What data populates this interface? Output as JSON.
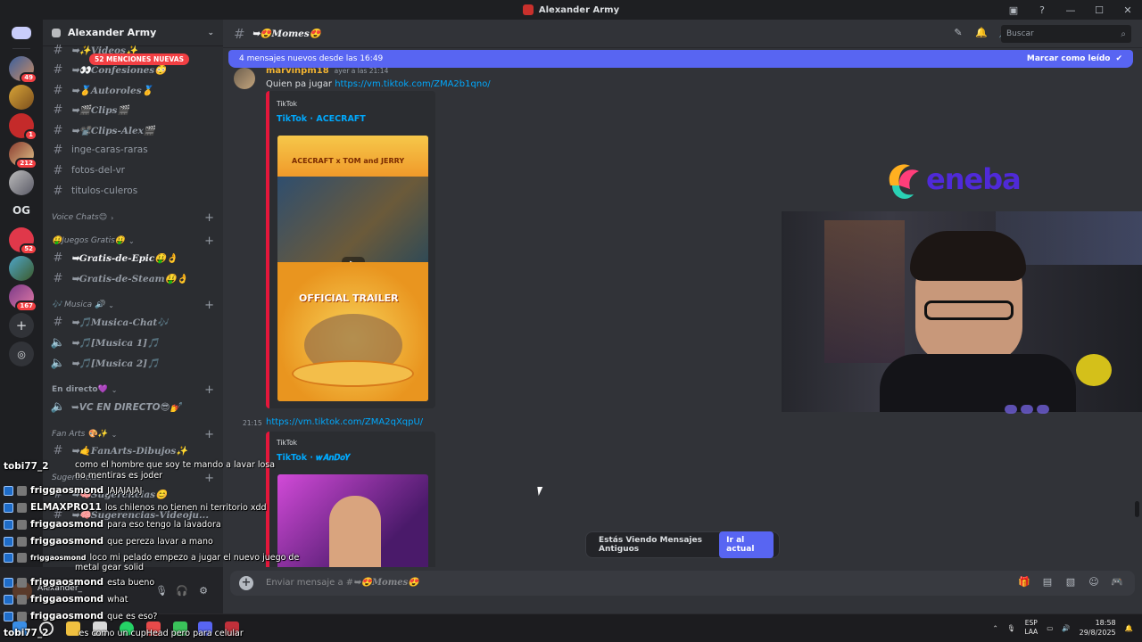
{
  "window": {
    "title": "Alexander Army"
  },
  "guilds": [
    {
      "badge": "49"
    },
    {
      "badge": ""
    },
    {
      "badge": "1"
    },
    {
      "badge": "212"
    },
    {
      "badge": ""
    },
    {
      "text": "OG"
    },
    {
      "badge": "52"
    },
    {
      "badge": ""
    },
    {
      "badge": "167"
    }
  ],
  "sidebar": {
    "server_name": "Alexander Army",
    "mentions_badge": "52 MENCIONES NUEVAS",
    "channels": [
      {
        "name": "➥✨𝑽𝒊𝒅𝒆𝒐𝒔✨"
      },
      {
        "name": "➥👀𝑪𝒐𝒏𝒇𝒆𝒔𝒊𝒐𝒏𝒆𝒔😳"
      },
      {
        "name": "➥🥇𝑨𝒖𝒕𝒐𝒓𝒐𝒍𝒆𝒔🥇"
      },
      {
        "name": "➥🎬𝑪𝒍𝒊𝒑𝒔🎬"
      },
      {
        "name": "➥📽️𝑪𝒍𝒊𝒑𝒔-𝑨𝒍𝒆𝒙🎬"
      },
      {
        "name": "inge-caras-raras"
      },
      {
        "name": "fotos-del-vr"
      },
      {
        "name": "titulos-culeros"
      },
      {
        "name": "➥𝑮𝒓𝒂𝒕𝒊𝒔-𝒅𝒆-𝑬𝒑𝒊𝒄🤑👌"
      },
      {
        "name": "➥𝑮𝒓𝒂𝒕𝒊𝒔-𝒅𝒆-𝑺𝒕𝒆𝒂𝒎🤑👌"
      },
      {
        "name": "➥🎵𝑴𝒖𝒔𝒊𝒄𝒂-𝑪𝒉𝒂𝒕🎶"
      },
      {
        "name": "➥🎵[𝑴𝒖𝒔𝒊𝒄𝒂 1]🎵"
      },
      {
        "name": "➥🎵[𝑴𝒖𝒔𝒊𝒄𝒂 2]🎵"
      },
      {
        "name": "➥VC EN DIRECTO😎💅"
      },
      {
        "name": "➥🤙𝑭𝒂𝒏𝑨𝒓𝒕𝒔-𝑫𝒊𝒃𝒖𝒋𝒐𝒔✨"
      },
      {
        "name": "➥🧠𝑺𝒖𝒈𝒆𝒓𝒆𝒏𝒄𝒊𝒂𝒔😊"
      },
      {
        "name": "➥🧠𝑺𝒖𝒈𝒆𝒓𝒆𝒏𝒄𝒊𝒂𝒔-𝑽𝒊𝒅𝒆𝒐𝒋𝒖..."
      }
    ],
    "categories": [
      {
        "name": "Voice Chats😊"
      },
      {
        "name": "🤑Juegos Gratis🤑"
      },
      {
        "name": "🎶 Musica 🔊"
      },
      {
        "name": "En directo💜"
      },
      {
        "name": "Fan Arts 🎨✨"
      },
      {
        "name": "Sugerencias"
      }
    ]
  },
  "user_panel": {
    "name": "Alexander_"
  },
  "chat": {
    "channel_title": "➥😍𝑴𝒐𝒎𝒆𝒔😍",
    "search_placeholder": "Buscar",
    "new_messages": "4 mensajes nuevos desde las 16:49",
    "mark_read": "Marcar como leído",
    "message": {
      "author": "marvinpm18",
      "time": "ayer a las 21:14",
      "text_prefix": "Quien pa jugar ",
      "link": "https://vm.tiktok.com/ZMA2b1qno/",
      "embed_provider": "TikTok",
      "embed_title": "TikTok · ACECRAFT"
    },
    "message2": {
      "stamp": "21:15",
      "link": "https://vm.tiktok.com/ZMA2qXqpU/",
      "embed_provider": "TikTok",
      "embed_title": "TikTok · 𝒘𝑨𝒏𝑫𝒐𝒀"
    },
    "thumb_texts": {
      "game": "ACECRAFT x TOM and JERRY",
      "trailer": "OFFICIAL TRAILER"
    },
    "old_notice": "Estás Viendo Mensajes Antiguos",
    "jump_button": "Ir al actual",
    "composer_prefix": "Enviar mensaje a #",
    "composer_channel": "➥😍𝑴𝒐𝒎𝒆𝒔😍"
  },
  "overlay": {
    "logo_text": "eneba",
    "lines": [
      {
        "user": "tobi77_2",
        "msg": ""
      },
      {
        "user": "",
        "msg": "como el hombre que soy te mando a lavar losa"
      },
      {
        "user": "",
        "msg": "no mentiras es joder"
      },
      {
        "user": "friggaosmond",
        "msg": "JAJAJAJAJ"
      },
      {
        "user": "ELMAXPRO11",
        "msg": "los chilenos no tienen ni territorio xdd"
      },
      {
        "user": "friggaosmond",
        "msg": "para eso tengo la lavadora"
      },
      {
        "user": "friggaosmond",
        "msg": "que pereza lavar a mano"
      },
      {
        "user": "friggaosmond",
        "msg": "loco mi pelado empezo a jugar el nuevo juego de"
      },
      {
        "user": "",
        "msg": "metal gear solid"
      },
      {
        "user": "friggaosmond",
        "msg": "esta bueno"
      },
      {
        "user": "friggaosmond",
        "msg": "what"
      },
      {
        "user": "friggaosmond",
        "msg": "que es eso?"
      },
      {
        "user": "tobi77_2",
        "msg": "es como un cupHead pero para celular"
      }
    ]
  },
  "taskbar": {
    "lang_top": "ESP",
    "lang_bottom": "LAA",
    "time": "18:58",
    "date": "29/8/2025"
  },
  "colors": {
    "blurple": "#5865f2",
    "chat_bg": "#313338",
    "sidebar_bg": "#2b2d31",
    "guild_bg": "#1e1f22",
    "link": "#00a8fc",
    "author": "#f0b232",
    "embed_border": "#e4173b"
  }
}
